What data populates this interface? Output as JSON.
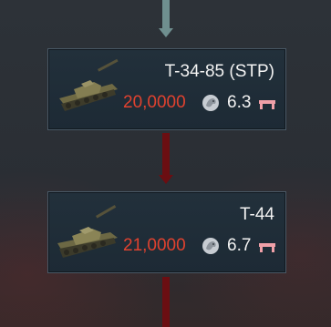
{
  "research_tree": {
    "vehicles": [
      {
        "name": "T-34-85 (STP)",
        "cost": "20,0000",
        "battle_rating": "6.3",
        "icon": "tank-thumbnail"
      },
      {
        "name": "T-44",
        "cost": "21,0000",
        "battle_rating": "6.7",
        "icon": "tank-thumbnail"
      }
    ]
  },
  "colors": {
    "cost": "#e0422f",
    "link_locked": "#6b0e12",
    "link_unlocked": "#6f8f8f",
    "card_bg": "#1f2c37"
  }
}
